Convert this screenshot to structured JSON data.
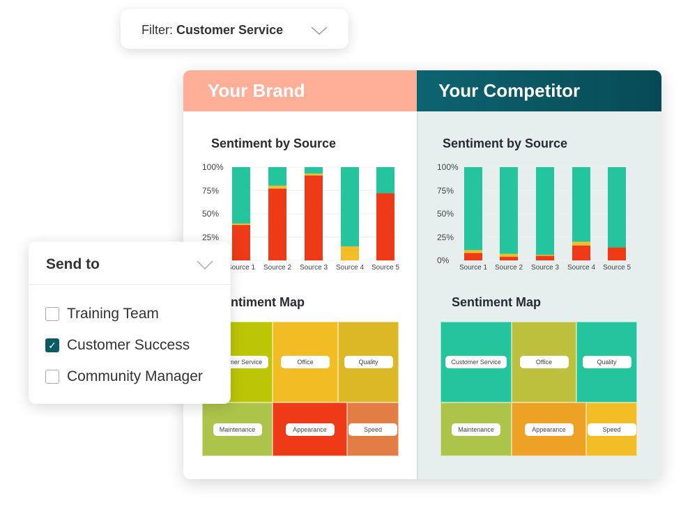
{
  "filter": {
    "label": "Filter:",
    "value": "Customer Service"
  },
  "brand": {
    "title": "Your Brand",
    "chart_title": "Sentiment by Source",
    "map_title": "Sentiment Map"
  },
  "competitor": {
    "title": "Your Competitor",
    "chart_title": "Sentiment by Source",
    "map_title": "Sentiment Map"
  },
  "send_to": {
    "title": "Send to",
    "options": [
      {
        "label": "Training Team",
        "checked": false
      },
      {
        "label": "Customer Success",
        "checked": true
      },
      {
        "label": "Community Manager",
        "checked": false
      }
    ]
  },
  "colors": {
    "negative": "#ee3a16",
    "neutral": "#f2bd27",
    "positive": "#24c49c"
  },
  "chart_data": [
    {
      "type": "bar",
      "stacked": true,
      "title": "Sentiment by Source",
      "categories": [
        "Source 1",
        "Source 2",
        "Source 3",
        "Source 4",
        "Source 5"
      ],
      "yticks": [
        "0%",
        "25%",
        "50%",
        "75%",
        "100%"
      ],
      "ylim": [
        0,
        100
      ],
      "series": [
        {
          "color": "#ee3a16",
          "values": [
            38,
            77,
            91,
            0,
            72
          ]
        },
        {
          "color": "#f2bd27",
          "values": [
            1.5,
            3,
            2,
            15,
            0
          ]
        },
        {
          "color": "#24c49c",
          "values": [
            60.5,
            20,
            7,
            85,
            28
          ]
        }
      ]
    },
    {
      "type": "bar",
      "stacked": true,
      "title": "Sentiment by Source",
      "categories": [
        "Source 1",
        "Source 2",
        "Source 3",
        "Source 4",
        "Source 5"
      ],
      "yticks": [
        "0%",
        "25%",
        "50%",
        "75%",
        "100%"
      ],
      "ylim": [
        0,
        100
      ],
      "series": [
        {
          "color": "#ee3a16",
          "values": [
            8,
            4,
            5,
            16,
            14
          ]
        },
        {
          "color": "#f2bd27",
          "values": [
            3,
            3,
            1,
            4,
            0
          ]
        },
        {
          "color": "#24c49c",
          "values": [
            89,
            93,
            94,
            80,
            86
          ]
        }
      ]
    }
  ],
  "brand_map": [
    {
      "label": "Customer Service",
      "color": "#bcc604"
    },
    {
      "label": "Office",
      "color": "#f2bc25"
    },
    {
      "label": "Quality",
      "color": "#dcb826"
    },
    {
      "label": "Maintenance",
      "color": "#adc44a"
    },
    {
      "label": "Appearance",
      "color": "#ee3a16"
    },
    {
      "label": "Speed",
      "color": "#e27e45"
    }
  ],
  "competitor_map": [
    {
      "label": "Customer Service",
      "color": "#24c49c"
    },
    {
      "label": "Office",
      "color": "#bcc03c"
    },
    {
      "label": "Quality",
      "color": "#24c49c"
    },
    {
      "label": "Maintenance",
      "color": "#adc44a"
    },
    {
      "label": "Appearance",
      "color": "#eea225"
    },
    {
      "label": "Speed",
      "color": "#f2bd27"
    }
  ]
}
